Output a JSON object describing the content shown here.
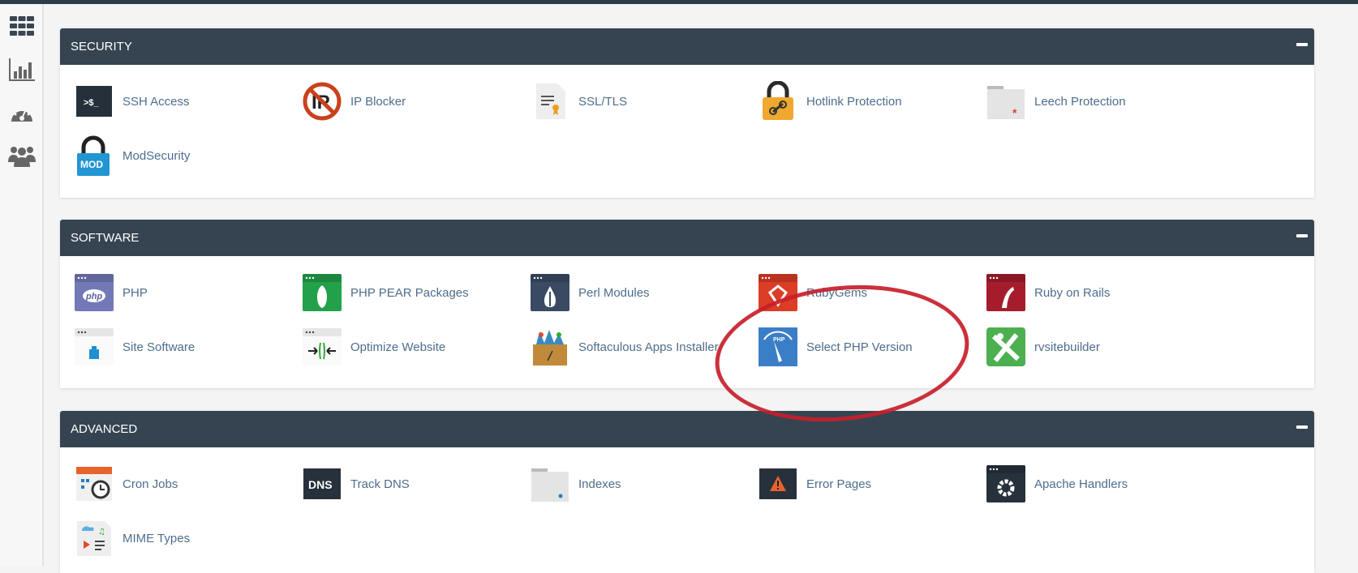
{
  "sidebar": {
    "items": [
      {
        "icon": "grid-icon"
      },
      {
        "icon": "bar-chart-icon"
      },
      {
        "icon": "dashboard-gauge-icon"
      },
      {
        "icon": "users-icon"
      }
    ]
  },
  "sections": [
    {
      "title": "SECURITY",
      "items": [
        {
          "label": "SSH Access",
          "icon": "ssh-terminal-icon"
        },
        {
          "label": "IP Blocker",
          "icon": "ip-blocker-icon"
        },
        {
          "label": "SSL/TLS",
          "icon": "ssl-certificate-icon"
        },
        {
          "label": "Hotlink Protection",
          "icon": "hotlink-lock-icon"
        },
        {
          "label": "Leech Protection",
          "icon": "leech-folder-icon"
        },
        {
          "label": "ModSecurity",
          "icon": "modsecurity-lock-icon"
        }
      ]
    },
    {
      "title": "SOFTWARE",
      "items": [
        {
          "label": "PHP",
          "icon": "php-icon"
        },
        {
          "label": "PHP PEAR Packages",
          "icon": "pear-icon"
        },
        {
          "label": "Perl Modules",
          "icon": "perl-onion-icon"
        },
        {
          "label": "RubyGems",
          "icon": "rubygems-icon"
        },
        {
          "label": "Ruby on Rails",
          "icon": "ruby-on-rails-icon"
        },
        {
          "label": "Site Software",
          "icon": "site-software-icon"
        },
        {
          "label": "Optimize Website",
          "icon": "optimize-website-icon"
        },
        {
          "label": "Softaculous Apps Installer",
          "icon": "softaculous-icon"
        },
        {
          "label": "Select PHP Version",
          "icon": "select-php-version-icon"
        },
        {
          "label": "rvsitebuilder",
          "icon": "rvsitebuilder-icon"
        }
      ]
    },
    {
      "title": "ADVANCED",
      "items": [
        {
          "label": "Cron Jobs",
          "icon": "cron-clock-icon"
        },
        {
          "label": "Track DNS",
          "icon": "dns-icon"
        },
        {
          "label": "Indexes",
          "icon": "indexes-folder-icon"
        },
        {
          "label": "Error Pages",
          "icon": "error-warning-icon"
        },
        {
          "label": "Apache Handlers",
          "icon": "apache-gear-icon"
        },
        {
          "label": "MIME Types",
          "icon": "mime-types-icon"
        }
      ]
    }
  ],
  "icon_lettering": {
    "ssh": ">$_",
    "ip": "IP",
    "mod": "MOD",
    "php": "php",
    "dns": "DNS",
    "phpver": "PHP"
  },
  "colors": {
    "header": "#364451",
    "link": "#4e6d8c",
    "highlight_circle": "#c5202b"
  }
}
